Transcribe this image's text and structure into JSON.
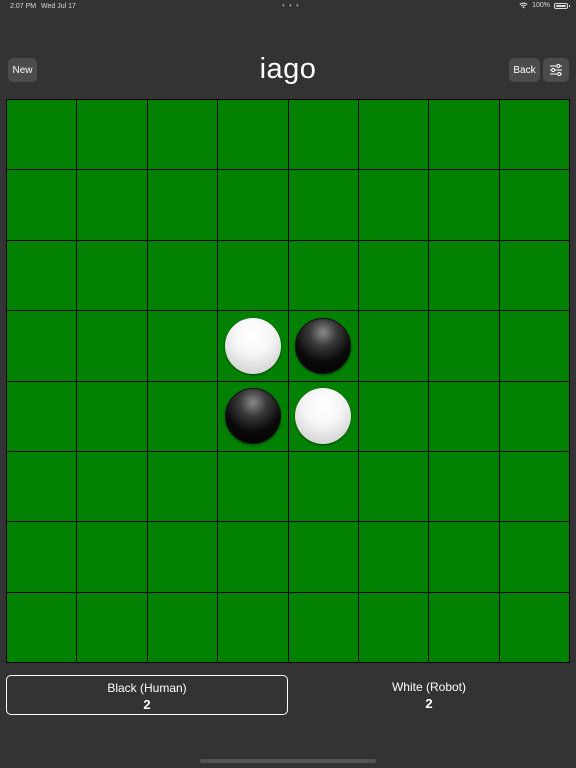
{
  "status_bar": {
    "time": "2:07 PM",
    "date": "Wed Jul 17",
    "dots": "• • •",
    "battery": "100%",
    "wifi_icon": "wifi-icon",
    "battery_icon": "battery-icon"
  },
  "nav": {
    "new_label": "New",
    "title": "iago",
    "back_label": "Back",
    "settings_icon": "sliders-icon"
  },
  "board": {
    "rows": 8,
    "cols": 8,
    "cell_color": "#028002",
    "grid_line_color": "#000000",
    "discs": [
      {
        "row": 4,
        "col": 4,
        "color": "white"
      },
      {
        "row": 4,
        "col": 5,
        "color": "black"
      },
      {
        "row": 5,
        "col": 4,
        "color": "black"
      },
      {
        "row": 5,
        "col": 5,
        "color": "white"
      }
    ]
  },
  "scores": {
    "black": {
      "label": "Black (Human)",
      "count": "2",
      "active": true
    },
    "white": {
      "label": "White (Robot)",
      "count": "2",
      "active": false
    }
  },
  "colors": {
    "background": "#333333",
    "button": "#4c4c4c",
    "text": "#ffffff"
  }
}
